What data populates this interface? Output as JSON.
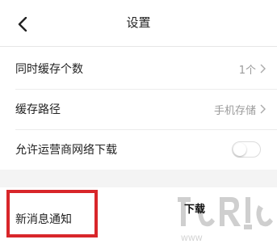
{
  "header": {
    "title": "设置",
    "back_icon": "chevron-left-icon"
  },
  "settings": {
    "cache_count": {
      "label": "同时缓存个数",
      "value": "1个"
    },
    "cache_path": {
      "label": "缓存路径",
      "value": "手机存储"
    },
    "allow_cellular": {
      "label": "允许运营商网络下载",
      "enabled": false
    },
    "new_message": {
      "label": "新消息通知"
    }
  },
  "watermark": {
    "text": "下载"
  },
  "colors": {
    "highlight_border": "#d8262a",
    "section_gap": "#f4f4f4",
    "secondary_text": "#9a9a9a"
  }
}
